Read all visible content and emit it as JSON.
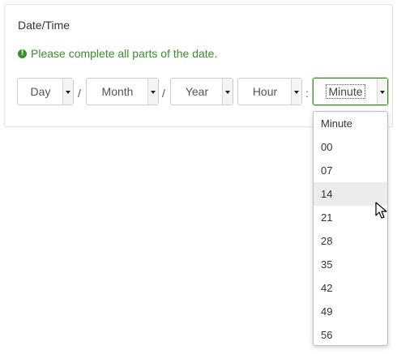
{
  "form": {
    "label": "Date/Time",
    "message": "Please complete all parts of the date.",
    "message_icon": "exclamation-circle-icon",
    "accent_color": "#3b8e2c"
  },
  "selects": {
    "day": "Day",
    "month": "Month",
    "year": "Year",
    "hour": "Hour",
    "minute": "Minute"
  },
  "separators": {
    "date1": "/",
    "date2": "/",
    "time": ":"
  },
  "minute_dropdown": {
    "options": [
      "Minute",
      "00",
      "07",
      "14",
      "21",
      "28",
      "35",
      "42",
      "49",
      "56"
    ],
    "hovered": "14"
  }
}
